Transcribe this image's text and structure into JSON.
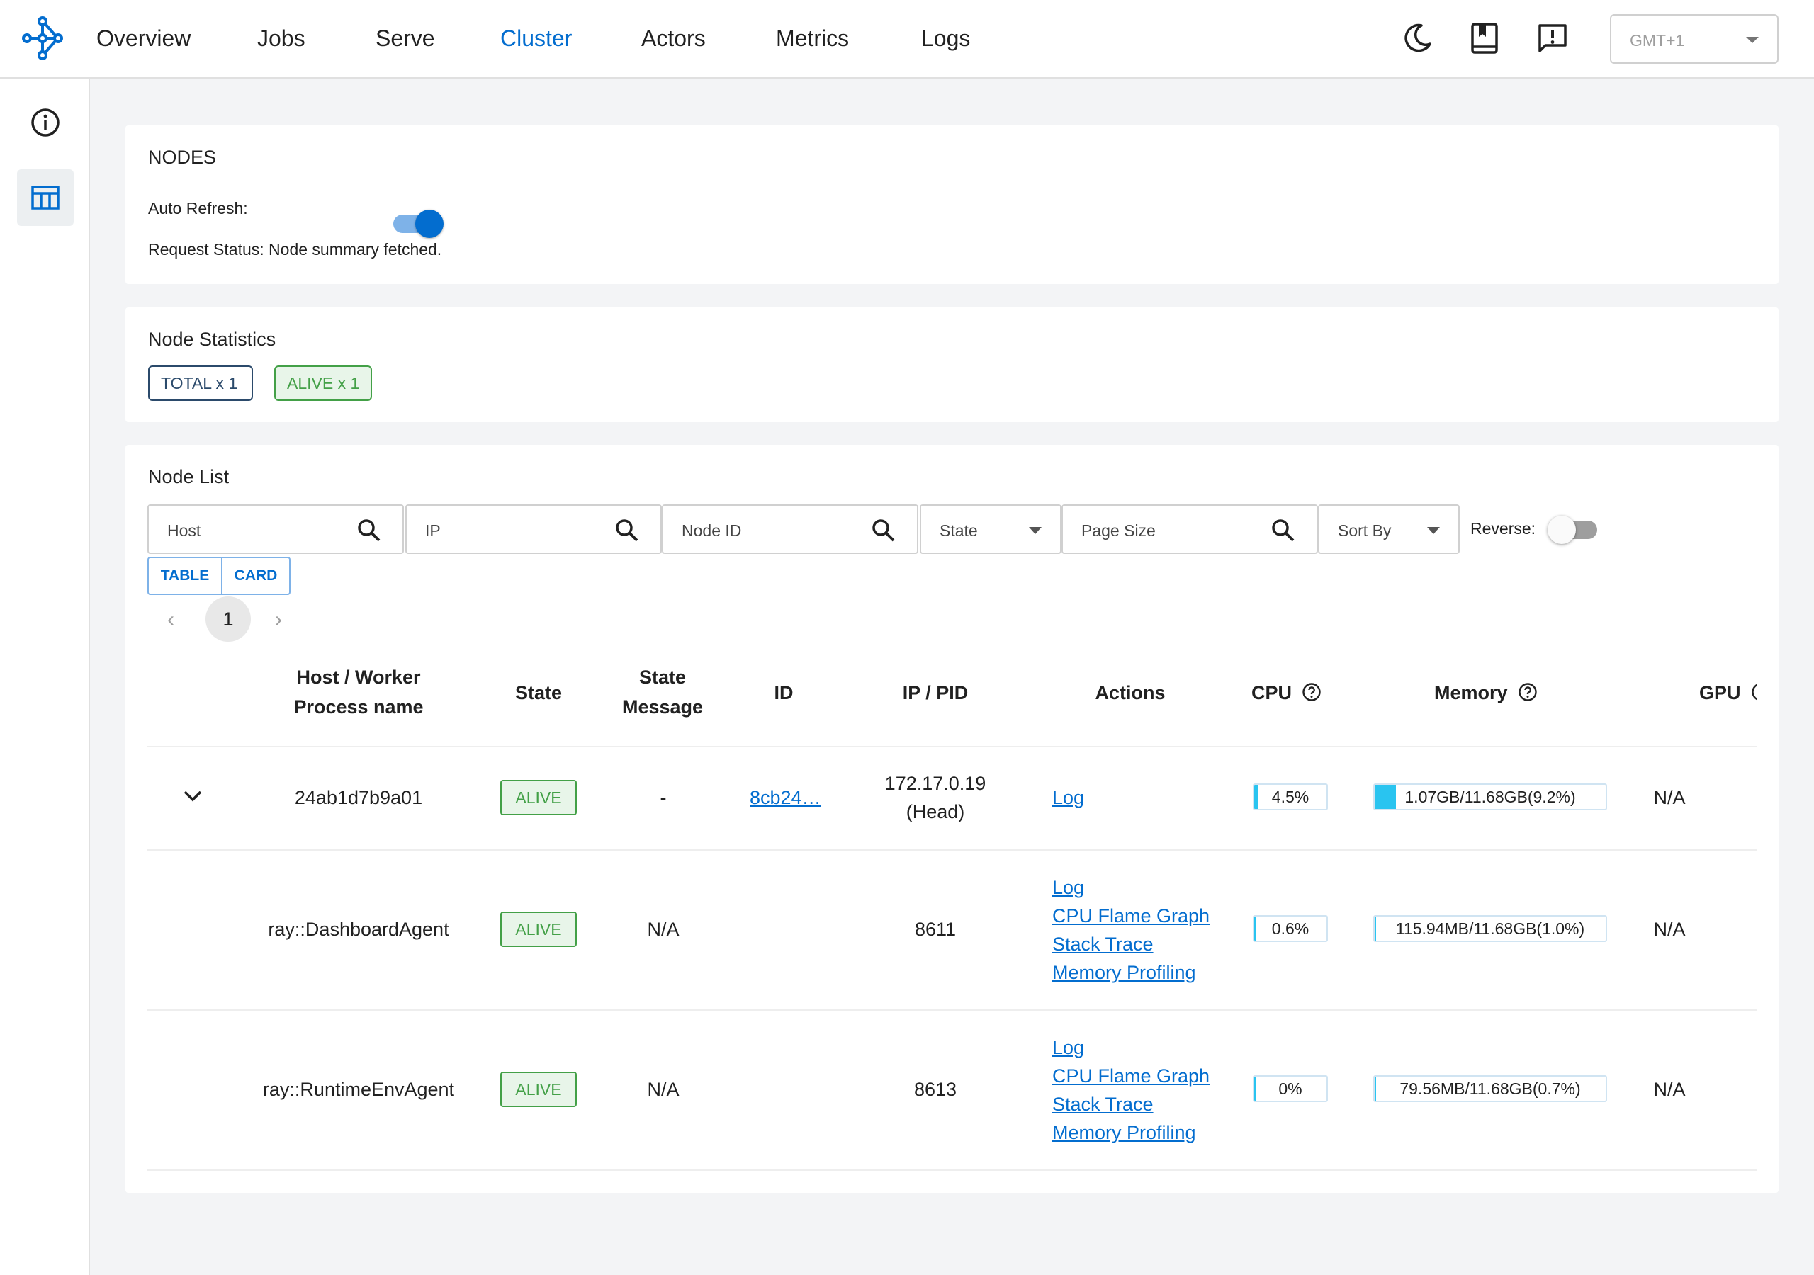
{
  "nav": {
    "items": [
      {
        "label": "Overview"
      },
      {
        "label": "Jobs"
      },
      {
        "label": "Serve"
      },
      {
        "label": "Cluster"
      },
      {
        "label": "Actors"
      },
      {
        "label": "Metrics"
      },
      {
        "label": "Logs"
      }
    ],
    "active": "Cluster",
    "timezone": "GMT+1"
  },
  "nodes_panel": {
    "title": "NODES",
    "auto_refresh_label": "Auto Refresh:",
    "auto_refresh_on": true,
    "request_status": "Request Status: Node summary fetched."
  },
  "stats_panel": {
    "title": "Node Statistics",
    "total_chip": "TOTAL x 1",
    "alive_chip": "ALIVE x 1"
  },
  "list_panel": {
    "title": "Node List",
    "filters": {
      "host": "Host",
      "ip": "IP",
      "node_id": "Node ID",
      "state": "State",
      "page_size": "Page Size",
      "sort_by": "Sort By",
      "reverse": "Reverse:"
    },
    "reverse_on": false,
    "view_table": "TABLE",
    "view_card": "CARD",
    "page": "1",
    "page_prev": "‹",
    "page_next": "›",
    "columns": {
      "host_line1": "Host / Worker",
      "host_line2": "Process name",
      "state": "State",
      "state_msg_line1": "State",
      "state_msg_line2": "Message",
      "id": "ID",
      "ip_pid": "IP / PID",
      "actions": "Actions",
      "cpu": "CPU",
      "memory": "Memory",
      "gpu": "GPU"
    },
    "rows": [
      {
        "name": "24ab1d7b9a01",
        "state": "ALIVE",
        "state_message": "-",
        "id": "8cb24…",
        "ip_line1": "172.17.0.19",
        "ip_line2": "(Head)",
        "actions": [
          "Log"
        ],
        "cpu_text": "4.5%",
        "cpu_fraction": 0.045,
        "mem_text": "1.07GB/11.68GB(9.2%)",
        "mem_fraction": 0.092,
        "gpu": "N/A"
      },
      {
        "name": "ray::DashboardAgent",
        "state": "ALIVE",
        "state_message": "N/A",
        "id": "",
        "ip_line1": "8611",
        "ip_line2": "",
        "actions": [
          "Log",
          "CPU Flame Graph",
          "Stack Trace",
          "Memory Profiling"
        ],
        "cpu_text": "0.6%",
        "cpu_fraction": 0.006,
        "mem_text": "115.94MB/11.68GB(1.0%)",
        "mem_fraction": 0.01,
        "gpu": "N/A"
      },
      {
        "name": "ray::RuntimeEnvAgent",
        "state": "ALIVE",
        "state_message": "N/A",
        "id": "",
        "ip_line1": "8613",
        "ip_line2": "",
        "actions": [
          "Log",
          "CPU Flame Graph",
          "Stack Trace",
          "Memory Profiling"
        ],
        "cpu_text": "0%",
        "cpu_fraction": 0.0,
        "mem_text": "79.56MB/11.68GB(0.7%)",
        "mem_fraction": 0.007,
        "gpu": "N/A"
      }
    ]
  },
  "colors": {
    "accent": "#036dcf",
    "alive_green": "#43a047",
    "usage_fill": "#29c4f0"
  },
  "icons": {
    "logo": "ray-logo-icon",
    "theme": "moon-icon",
    "docs": "book-icon",
    "feedback": "feedback-icon",
    "sidebar_info": "info-icon",
    "sidebar_table": "table-icon"
  }
}
